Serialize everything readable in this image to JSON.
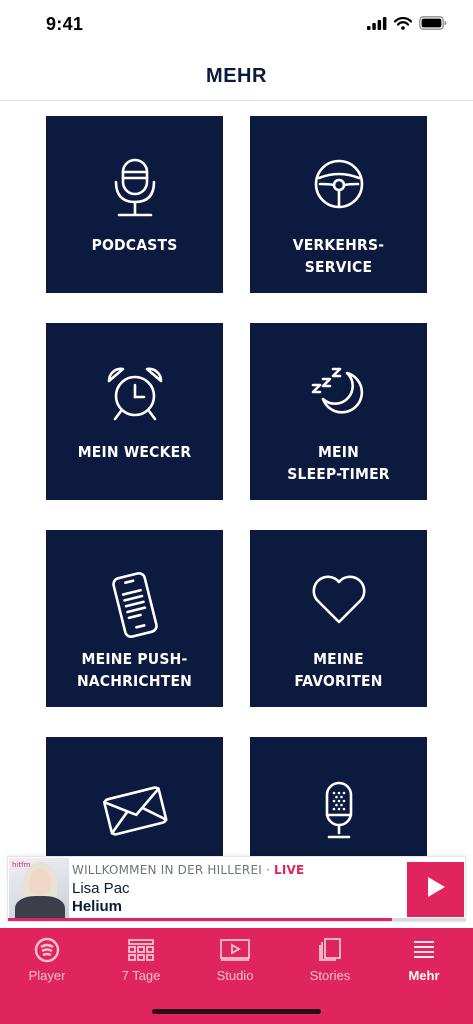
{
  "status_bar": {
    "time": "9:41",
    "icons": [
      "signal-icon",
      "wifi-icon",
      "battery-icon"
    ]
  },
  "header": {
    "title": "MEHR"
  },
  "tiles": [
    {
      "label": "PODCASTS",
      "icon": "microphone-icon"
    },
    {
      "label": "VERKEHRS-\nSERVICE",
      "icon": "steering-wheel-icon"
    },
    {
      "label": "MEIN WECKER",
      "icon": "alarm-clock-icon"
    },
    {
      "label": "MEIN\nSLEEP-TIMER",
      "icon": "moon-sleep-icon"
    },
    {
      "label": "MEINE PUSH-\nNACHRICHTEN",
      "icon": "smartphone-icon"
    },
    {
      "label": "MEINE\nFAVORITEN",
      "icon": "heart-icon"
    },
    {
      "label": "",
      "icon": "envelope-icon"
    },
    {
      "label": "",
      "icon": "studio-microphone-icon"
    }
  ],
  "mini_player": {
    "show": "WILLKOMMEN IN DER HILLEREI",
    "separator": "·",
    "live": "LIVE",
    "artist": "Lisa Pac",
    "track": "Helium",
    "cover_brand": "hitfm",
    "progress_fraction": 0.84,
    "play_icon": "play-icon"
  },
  "tab_bar": {
    "tabs": [
      {
        "label": "Player",
        "icon": "station-logo-icon",
        "active": false
      },
      {
        "label": "7 Tage",
        "icon": "calendar-grid-icon",
        "active": false
      },
      {
        "label": "Studio",
        "icon": "video-play-icon",
        "active": false
      },
      {
        "label": "Stories",
        "icon": "stacked-pages-icon",
        "active": false
      },
      {
        "label": "Mehr",
        "icon": "menu-lines-icon",
        "active": true
      }
    ]
  },
  "colors": {
    "navy": "#0b1a3e",
    "accent": "#e0245e",
    "white": "#ffffff"
  }
}
